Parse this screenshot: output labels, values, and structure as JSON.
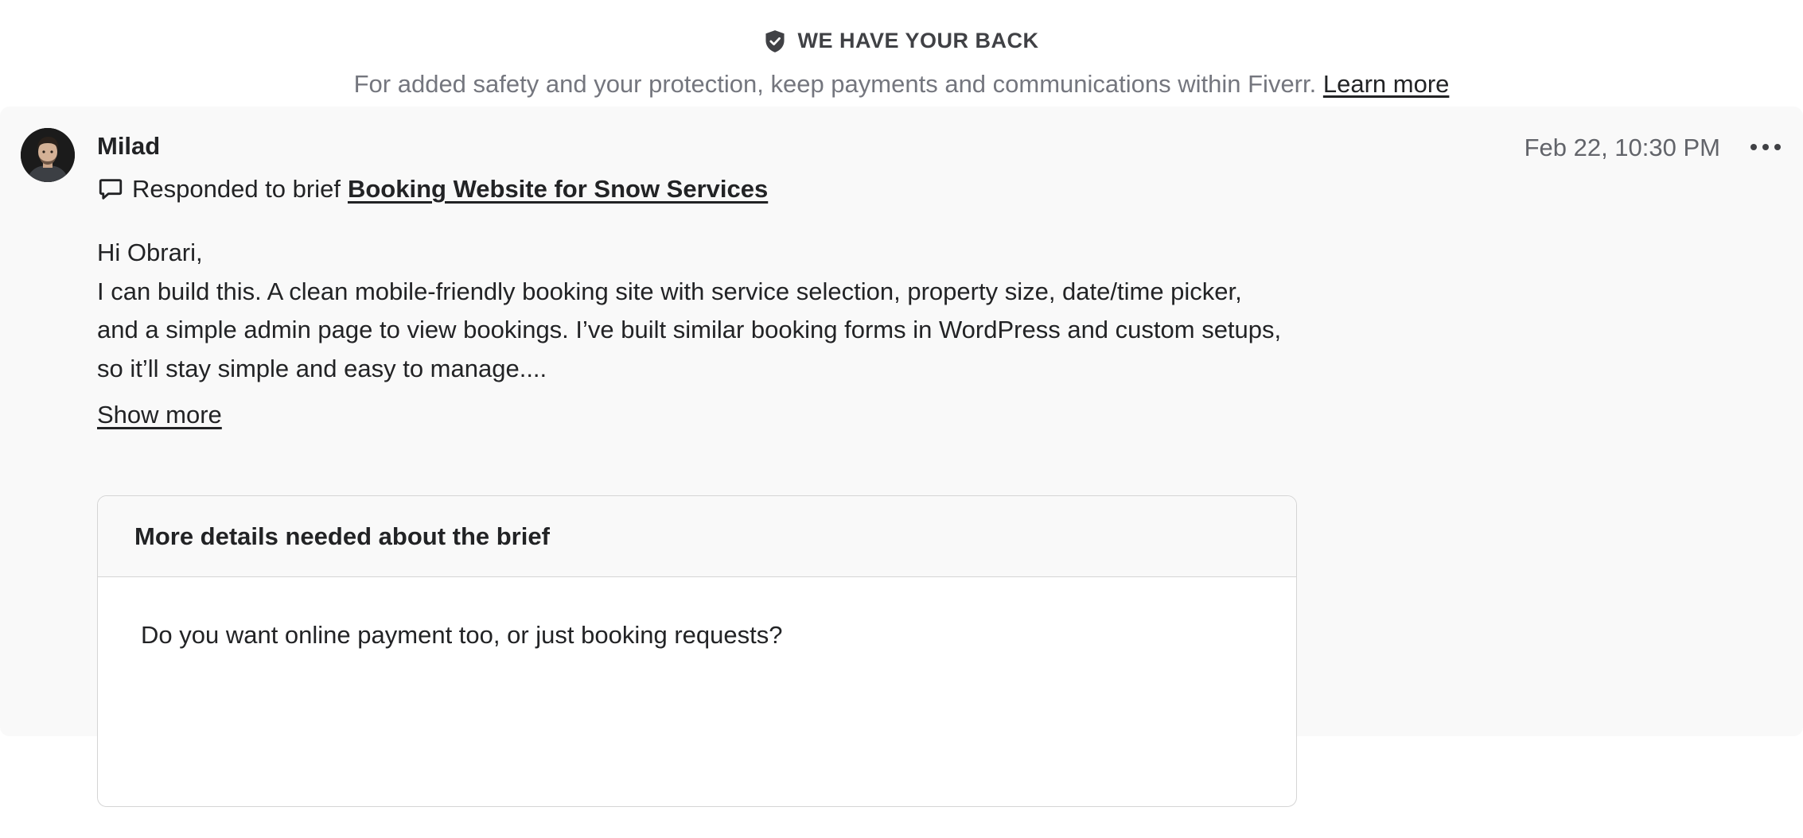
{
  "safety_banner": {
    "title": "WE HAVE YOUR BACK",
    "text": "For added safety and your protection, keep payments and communications within Fiverr.",
    "link_label": "Learn more"
  },
  "message": {
    "sender_name": "Milad",
    "timestamp": "Feb 22, 10:30 PM",
    "brief_prefix": "Responded to brief",
    "brief_title": "Booking Website for Snow Services",
    "greeting": "Hi Obrari,",
    "body": "I can build this. A clean mobile-friendly booking site with service selection, property size, date/time picker, and a simple admin page to view bookings. I’ve built similar booking forms in WordPress and custom setups, so it’ll stay simple and easy to manage....",
    "show_more_label": "Show more",
    "details_card": {
      "title": "More details needed about the brief",
      "question": "Do you want online payment too, or just booking requests?"
    }
  },
  "colors": {
    "message_background": "#f9f9f9",
    "text_primary": "#222325",
    "text_secondary": "#74767e",
    "border": "#d5d5d5"
  },
  "icons": {
    "banner_icon": "shield-check-icon",
    "brief_icon": "chat-bubble-icon",
    "menu_icon": "more-horizontal-icon"
  }
}
